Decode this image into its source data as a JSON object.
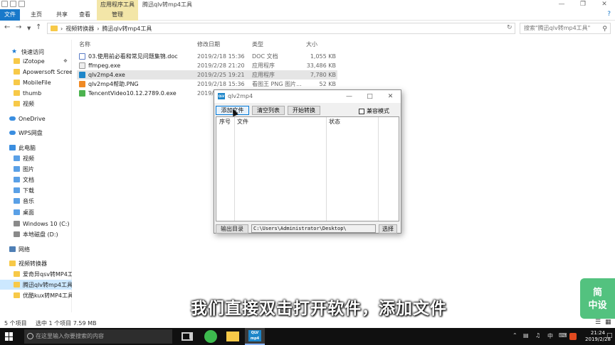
{
  "window": {
    "context_tab": "应用程序工具",
    "title": "腾迅qlv转mp4工具"
  },
  "ribbon": {
    "tabs": [
      "文件",
      "主页",
      "共享",
      "查看",
      "管理"
    ]
  },
  "address": {
    "breadcrumb": [
      "视频转换器",
      "腾迅qlv转mp4工具"
    ],
    "search_placeholder": "搜索\"腾迅qlv转mp4工具\""
  },
  "sidebar": {
    "items": [
      {
        "label": "快速访问",
        "icon": "star-icon",
        "level": 0
      },
      {
        "label": "iZotope",
        "icon": "folder-icon",
        "level": 1,
        "pinned": true
      },
      {
        "label": "Apowersoft Scree",
        "icon": "folder-icon",
        "level": 1
      },
      {
        "label": "MobileFile",
        "icon": "folder-icon",
        "level": 1
      },
      {
        "label": "thumb",
        "icon": "folder-icon",
        "level": 1
      },
      {
        "label": "视频",
        "icon": "folder-icon",
        "level": 1
      },
      {
        "label": "OneDrive",
        "icon": "cloud-icon",
        "level": 0
      },
      {
        "label": "WPS网盘",
        "icon": "cloud-icon",
        "level": 0
      },
      {
        "label": "此电脑",
        "icon": "computer-icon",
        "level": 0
      },
      {
        "label": "视频",
        "icon": "video-folder-icon",
        "level": 1
      },
      {
        "label": "图片",
        "icon": "picture-folder-icon",
        "level": 1
      },
      {
        "label": "文档",
        "icon": "document-folder-icon",
        "level": 1
      },
      {
        "label": "下载",
        "icon": "download-folder-icon",
        "level": 1
      },
      {
        "label": "音乐",
        "icon": "music-folder-icon",
        "level": 1
      },
      {
        "label": "桌面",
        "icon": "desktop-folder-icon",
        "level": 1
      },
      {
        "label": "Windows 10 (C:)",
        "icon": "drive-icon",
        "level": 1
      },
      {
        "label": "本地磁盘 (D:)",
        "icon": "drive-icon",
        "level": 1
      },
      {
        "label": "网络",
        "icon": "network-icon",
        "level": 0
      },
      {
        "label": "视频转换器",
        "icon": "folder-icon",
        "level": 0
      },
      {
        "label": "爱奇异qsv转MP4工",
        "icon": "folder-icon",
        "level": 1
      },
      {
        "label": "腾迅qlv转mp4工具",
        "icon": "folder-icon",
        "level": 1,
        "selected": true
      },
      {
        "label": "优酷kux转MP4工具",
        "icon": "folder-icon",
        "level": 1
      }
    ]
  },
  "filelist": {
    "columns": [
      "名称",
      "修改日期",
      "类型",
      "大小"
    ],
    "rows": [
      {
        "name": "03.使用前必看和常见问题集锦.doc",
        "date": "2019/2/18 15:36",
        "type": "DOC 文档",
        "size": "1,055 KB",
        "icon": "doc-file-icon"
      },
      {
        "name": "ffmpeg.exe",
        "date": "2019/2/28 21:20",
        "type": "应用程序",
        "size": "33,486 KB",
        "icon": "exe-file-icon"
      },
      {
        "name": "qlv2mp4.exe",
        "date": "2019/2/25 19:21",
        "type": "应用程序",
        "size": "7,780 KB",
        "icon": "qlv-app-icon",
        "selected": true
      },
      {
        "name": "qlv2mp4帮助.PNG",
        "date": "2019/2/18 15:36",
        "type": "看图王 PNG 图片...",
        "size": "52 KB",
        "icon": "png-file-icon"
      },
      {
        "name": "TencentVideo10.12.2789.0.exe",
        "date": "2019/2",
        "type": "",
        "size": "",
        "icon": "tencent-video-icon"
      }
    ]
  },
  "dialog": {
    "title": "qlv2mp4",
    "add_file": "添加文件",
    "clear_list": "清空列表",
    "start_convert": "开始转换",
    "compat_mode": "兼容模式",
    "list_headers": [
      "序号",
      "文件",
      "状态"
    ],
    "output_dir_label": "输出目录",
    "output_path": "C:\\Users\\Administrator\\Desktop\\",
    "browse": "选择"
  },
  "statusbar": {
    "item_count": "5 个项目",
    "selection": "选中 1 个项目  7.59 MB"
  },
  "subtitle": "我们直接双击打开软件，添加文件",
  "watermark": "简\n中设",
  "taskbar": {
    "search_placeholder": "在这里输入你要搜索的内容",
    "tray_ime": "中",
    "time": "21:24",
    "date": "2019/2/28"
  },
  "colors": {
    "accent": "#1979ca",
    "context_tab": "#f3e6a8",
    "selection": "#cce8ff"
  }
}
